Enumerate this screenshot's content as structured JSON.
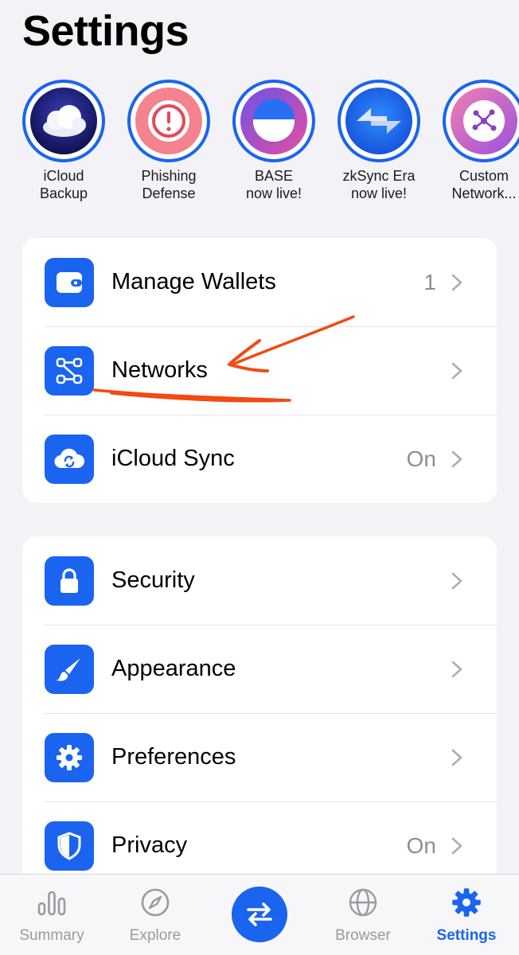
{
  "page": {
    "title": "Settings"
  },
  "stories": [
    {
      "line1": "iCloud",
      "line2": "Backup",
      "icon": "cloud-icon"
    },
    {
      "line1": "Phishing",
      "line2": "Defense",
      "icon": "exclamation-icon"
    },
    {
      "line1": "BASE",
      "line2": "now live!",
      "icon": "base-logo-icon"
    },
    {
      "line1": "zkSync Era",
      "line2": "now live!",
      "icon": "zksync-logo-icon"
    },
    {
      "line1": "Custom",
      "line2": "Network...",
      "icon": "custom-network-icon"
    }
  ],
  "group1": [
    {
      "label": "Manage Wallets",
      "value": "1",
      "icon": "wallet-icon"
    },
    {
      "label": "Networks",
      "value": "",
      "icon": "network-icon"
    },
    {
      "label": "iCloud Sync",
      "value": "On",
      "icon": "icloud-sync-icon"
    }
  ],
  "group2": [
    {
      "label": "Security",
      "value": "",
      "icon": "lock-icon"
    },
    {
      "label": "Appearance",
      "value": "",
      "icon": "brush-icon"
    },
    {
      "label": "Preferences",
      "value": "",
      "icon": "gear-icon"
    },
    {
      "label": "Privacy",
      "value": "On",
      "icon": "shield-icon"
    }
  ],
  "tabbar": {
    "tabs": [
      {
        "label": "Summary",
        "icon": "bar-chart-icon"
      },
      {
        "label": "Explore",
        "icon": "compass-icon"
      },
      {
        "label": "Browser",
        "icon": "globe-icon"
      },
      {
        "label": "Settings",
        "icon": "gear-icon",
        "active": true
      }
    ],
    "swap_icon": "swap-arrows-icon"
  },
  "colors": {
    "accent": "#1a64f0",
    "background": "#f2f2f7",
    "annotation": "#f24a12"
  }
}
